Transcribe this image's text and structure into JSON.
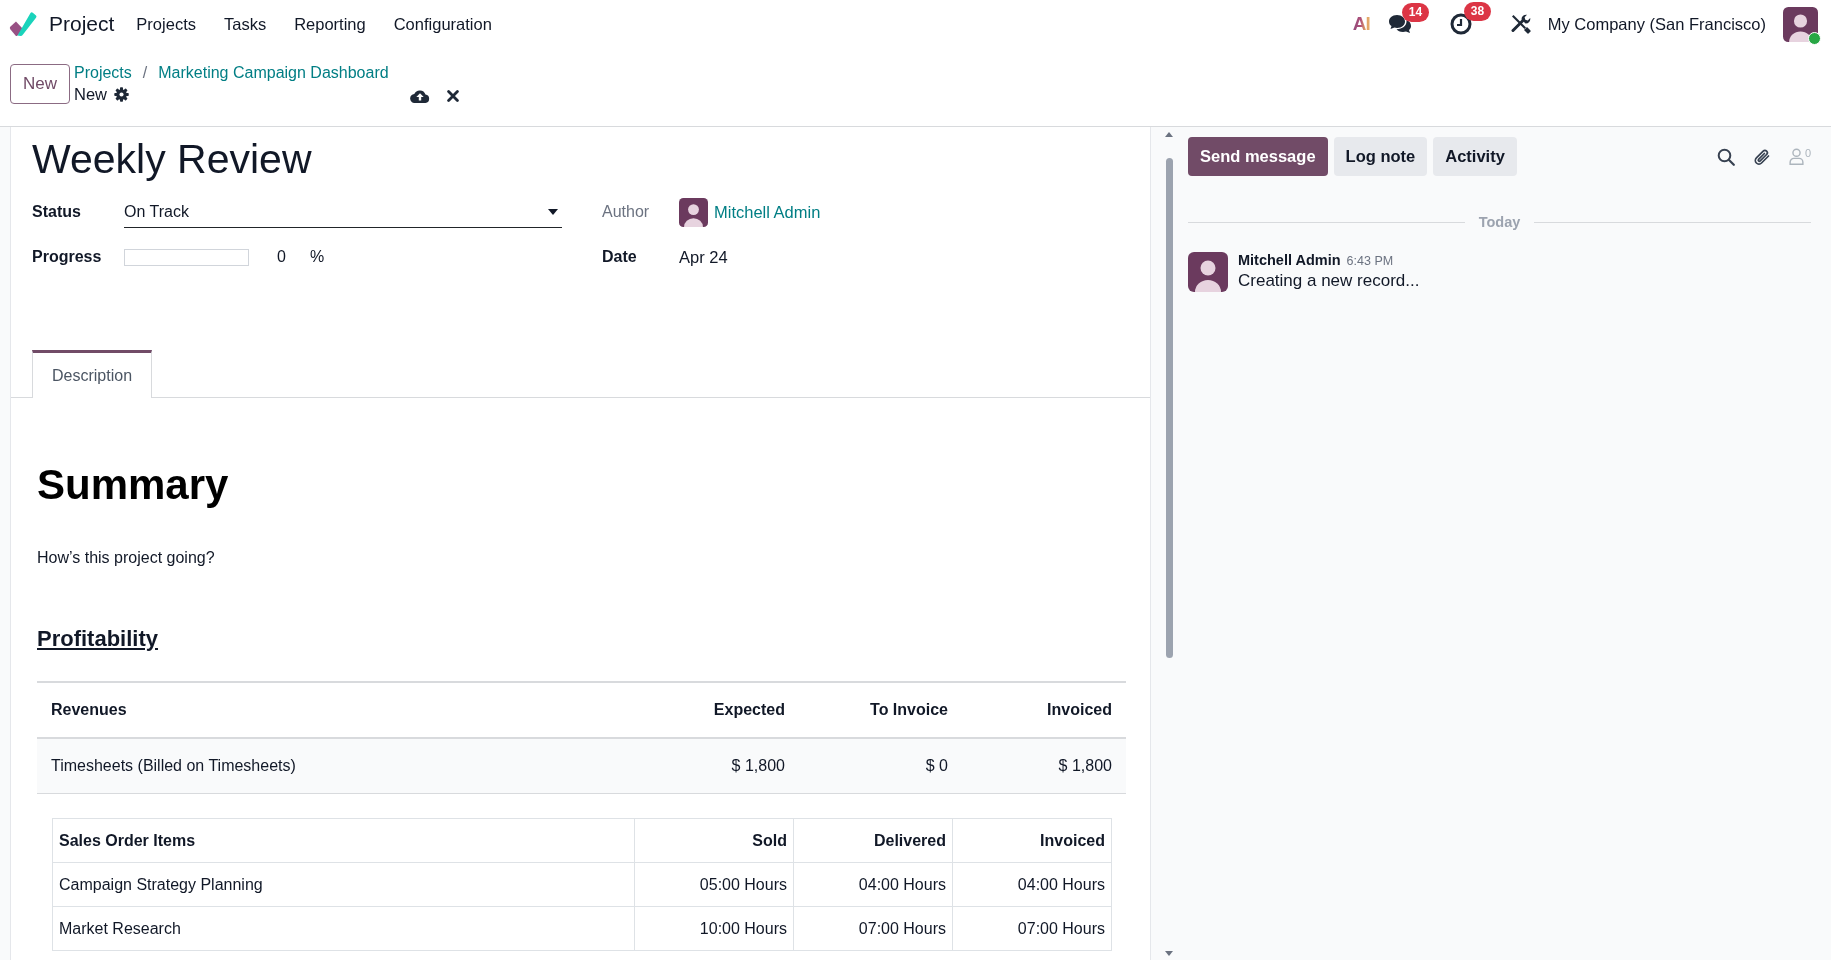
{
  "navbar": {
    "app_name": "Project",
    "menu": [
      {
        "label": "Projects"
      },
      {
        "label": "Tasks"
      },
      {
        "label": "Reporting"
      },
      {
        "label": "Configuration"
      }
    ],
    "ai_label": "AI",
    "messages_badge": "14",
    "activities_badge": "38",
    "company": "My Company (San Francisco)",
    "user_online": true
  },
  "control_panel": {
    "new_button": "New",
    "breadcrumbs": [
      "Projects",
      "Marketing Campaign Dashboard"
    ],
    "separator": "/",
    "record_name": "New"
  },
  "form": {
    "title": "Weekly Review",
    "columns": [
      {
        "fields": [
          {
            "kind": "select",
            "label": "Status",
            "value": "On Track",
            "readonly": false
          },
          {
            "kind": "progress",
            "label": "Progress",
            "level": 0,
            "value": "0",
            "unit": "%",
            "readonly": false
          }
        ]
      },
      {
        "fields": [
          {
            "kind": "user",
            "label": "Author",
            "value": "Mitchell Admin",
            "readonly": true
          },
          {
            "kind": "text",
            "label": "Date",
            "value": "Apr 24",
            "readonly": false
          }
        ]
      }
    ]
  },
  "tabs": [
    {
      "label": "Description",
      "selected": true
    }
  ],
  "description": {
    "heading": "Summary",
    "intro": "How’s this project going?",
    "section_title": "Profitability",
    "revenues_table": {
      "columns": [
        "Revenues",
        "Expected",
        "To Invoice",
        "Invoiced"
      ],
      "rows": [
        [
          "Timesheets (Billed on Timesheets)",
          "$ 1,800",
          "$ 0",
          "$ 1,800"
        ]
      ]
    },
    "sales_table": {
      "columns": [
        "Sales Order Items",
        "Sold",
        "Delivered",
        "Invoiced"
      ],
      "rows": [
        [
          "Campaign Strategy Planning",
          "05:00 Hours",
          "04:00 Hours",
          "04:00 Hours"
        ],
        [
          "Market Research",
          "10:00 Hours",
          "07:00 Hours",
          "07:00 Hours"
        ]
      ]
    }
  },
  "chatter": {
    "buttons": [
      {
        "label": "Send message",
        "kind": "primary"
      },
      {
        "label": "Log note",
        "kind": "secondary"
      },
      {
        "label": "Activity",
        "kind": "secondary"
      }
    ],
    "followers": "0",
    "date_divider": "Today",
    "messages": [
      {
        "author": "Mitchell Admin",
        "time": "6:43 PM",
        "body": "Creating a new record..."
      }
    ]
  }
}
